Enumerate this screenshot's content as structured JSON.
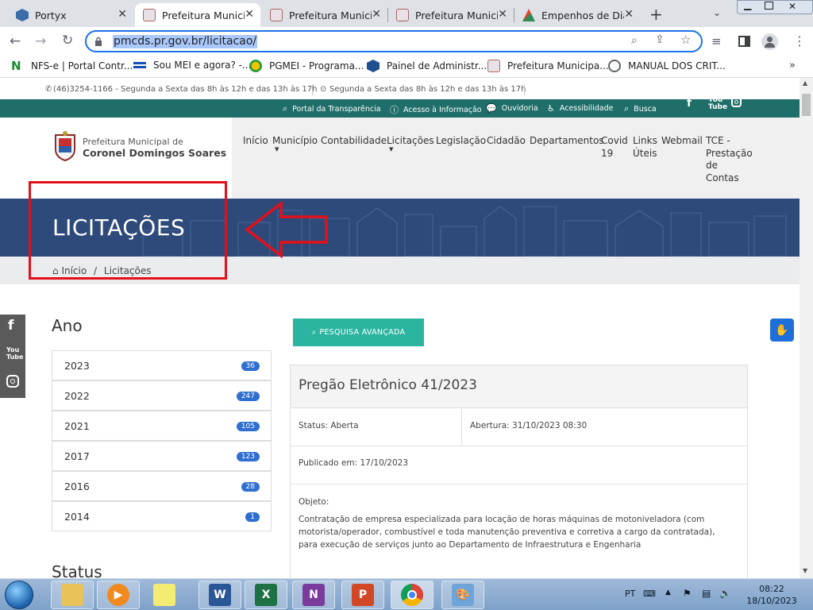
{
  "tabs": [
    {
      "title": "Portyx"
    },
    {
      "title": "Prefeitura Municipal"
    },
    {
      "title": "Prefeitura Municipal"
    },
    {
      "title": "Prefeitura Municipal"
    },
    {
      "title": "Empenhos de Diária"
    }
  ],
  "address": {
    "url": "pmcds.pr.gov.br/licitacao/"
  },
  "bookmarks": [
    {
      "label": "NFS-e | Portal Contr..."
    },
    {
      "label": "Sou MEI e agora? -..."
    },
    {
      "label": "PGMEI - Programa..."
    },
    {
      "label": "Painel de Administr..."
    },
    {
      "label": "Prefeitura Municipa..."
    },
    {
      "label": "MANUAL DOS CRIT..."
    }
  ],
  "topinfo": {
    "phone": "(46)3254-1166 - Segunda a Sexta das 8h às 12h e das 13h às 17h",
    "hours": "Segunda a Sexta das 8h às 12h e das 13h às 17h"
  },
  "greenbar": {
    "transparency": "Portal da Transparência",
    "info": "Acesso à Informação",
    "ombudsman": "Ouvidoria",
    "accessibility": "Acessibilidade",
    "search": "Busca"
  },
  "logo": {
    "line1": "Prefeitura Municipal de",
    "line2": "Coronel Domingos Soares"
  },
  "nav": [
    {
      "label": "Início"
    },
    {
      "label": "Município"
    },
    {
      "label": "Contabilidade"
    },
    {
      "label": "Licitações"
    },
    {
      "label": "Legislação"
    },
    {
      "label": "Cidadão"
    },
    {
      "label": "Departamentos"
    },
    {
      "label": "Covid 19"
    },
    {
      "label": "Links Úteis"
    },
    {
      "label": "Webmail"
    },
    {
      "label": "TCE - Prestação de Contas"
    }
  ],
  "banner": {
    "title": "LICITAÇÕES"
  },
  "breadcrumb": {
    "home": "Início",
    "sep": "/",
    "current": "Licitações"
  },
  "sidebar": {
    "ano_title": "Ano",
    "years": [
      {
        "year": "2023",
        "count": "36"
      },
      {
        "year": "2022",
        "count": "247"
      },
      {
        "year": "2021",
        "count": "105"
      },
      {
        "year": "2017",
        "count": "123"
      },
      {
        "year": "2016",
        "count": "28"
      },
      {
        "year": "2014",
        "count": "1"
      }
    ],
    "status_title": "Status"
  },
  "search_button": {
    "label": "PESQUISA AVANÇADA"
  },
  "card": {
    "title": "Pregão Eletrônico 41/2023",
    "status": "Status: Aberta",
    "opening": "Abertura: 31/10/2023 08:30",
    "published": "Publicado em: 17/10/2023",
    "object_label": "Objeto:",
    "object_text": "Contratação de empresa especializada para locação de horas máquinas de motoniveladora (com motorista/operador, combustível e toda manutenção preventiva e corretiva a cargo da contratada), para execução de serviços junto ao Departamento de Infraestrutura e Engenharia"
  },
  "taskbar": {
    "lang": "PT",
    "time": "08:22",
    "date": "18/10/2023"
  },
  "colors": {
    "accent": "#1a73e8",
    "teal": "#2bb5a0",
    "green_bar": "#1f6e6a",
    "banner": "#2d4a7a",
    "annotation_red": "#e3101b"
  }
}
